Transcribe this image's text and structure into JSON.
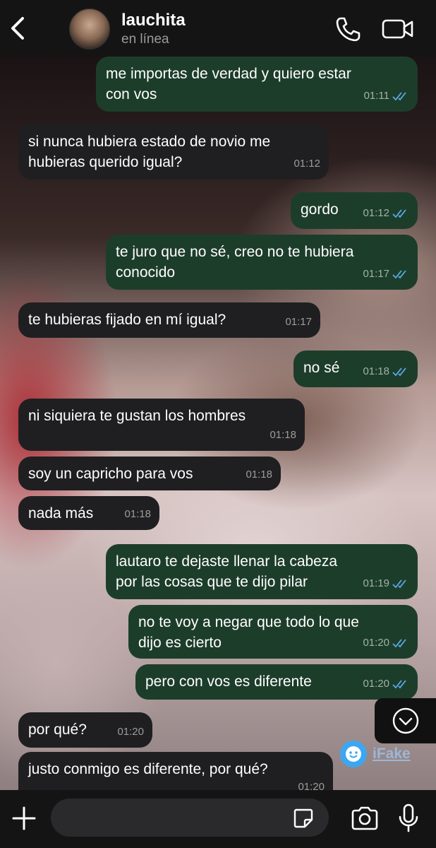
{
  "header": {
    "contact_name": "lauchita",
    "status": "en línea",
    "icons": [
      "back-icon",
      "phone-icon",
      "video-camera-icon"
    ]
  },
  "messages": [
    {
      "dir": "out",
      "text": "me importas de verdad y quiero estar\ncon vos",
      "time": "01:11",
      "read": true
    },
    {
      "dir": "in",
      "text": "si nunca hubiera estado de novio me\nhubieras querido igual?",
      "time": "01:12"
    },
    {
      "dir": "out",
      "text": "gordo",
      "time": "01:12",
      "read": true
    },
    {
      "dir": "out",
      "text": "te juro que no sé, creo no te hubiera\nconocido",
      "time": "01:17",
      "read": true
    },
    {
      "dir": "in",
      "text": "te hubieras fijado en mí igual?",
      "time": "01:17"
    },
    {
      "dir": "out",
      "text": "no sé",
      "time": "01:18",
      "read": true
    },
    {
      "dir": "in",
      "text": "ni siquiera te gustan los hombres",
      "time": "01:18"
    },
    {
      "dir": "in",
      "text": "soy un capricho para vos",
      "time": "01:18"
    },
    {
      "dir": "in",
      "text": "nada más",
      "time": "01:18"
    },
    {
      "dir": "out",
      "text": "lautaro te dejaste llenar la cabeza\npor las cosas que te dijo pilar",
      "time": "01:19",
      "read": true
    },
    {
      "dir": "out",
      "text": "no te voy a negar que todo lo que\ndijo es cierto",
      "time": "01:20",
      "read": true
    },
    {
      "dir": "out",
      "text": "pero con vos es diferente",
      "time": "01:20",
      "read": true
    },
    {
      "dir": "in",
      "text": "por qué?",
      "time": "01:20"
    },
    {
      "dir": "in",
      "text": "justo conmigo es diferente, por qué?",
      "time": "01:20"
    }
  ],
  "watermark": {
    "text": "iFake"
  },
  "input": {
    "placeholder": "",
    "value": ""
  },
  "colors": {
    "outgoing_bubble": "#1d3d2b",
    "incoming_bubble": "#1f1f21",
    "read_ticks": "#5aa9e6",
    "bar": "#141414"
  }
}
